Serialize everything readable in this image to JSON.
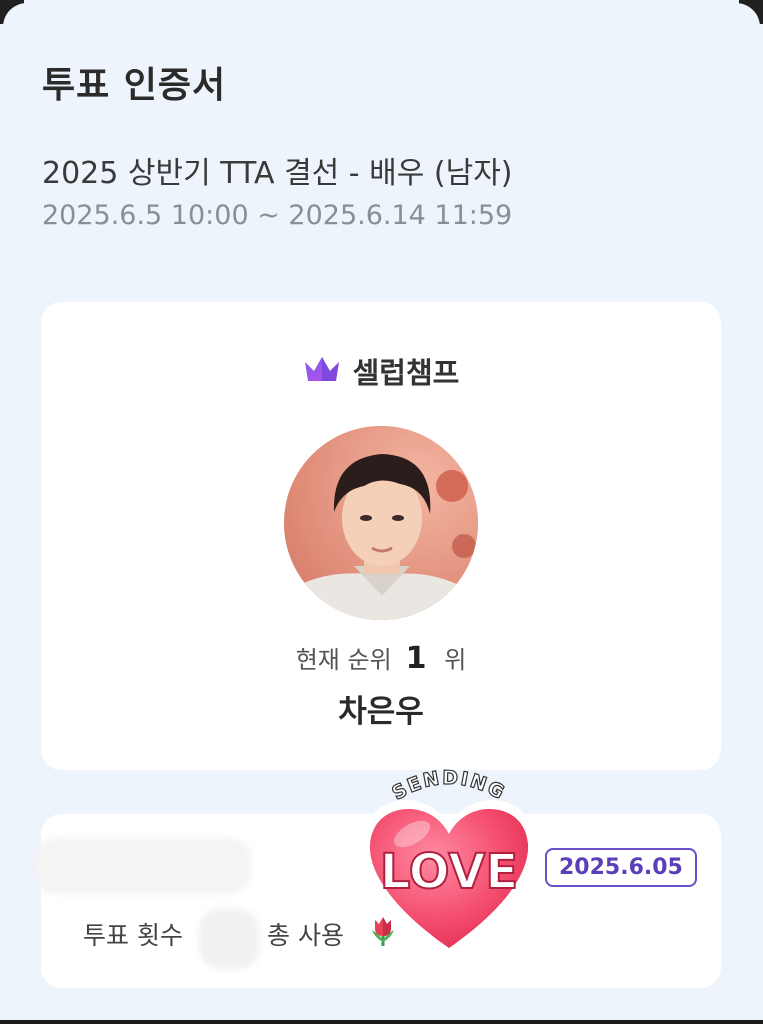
{
  "header": {
    "title": "투표 인증서",
    "event_title": "2025 상반기 TTA 결선 - 배우 (남자)",
    "event_period": "2025.6.5 10:00 ~ 2025.6.14 11:59"
  },
  "brand": {
    "name": "셀럽챔프",
    "icon": "crown-icon",
    "icon_colors": [
      "#7b5cf5",
      "#c14ee0"
    ]
  },
  "candidate": {
    "rank_label": "현재 순위",
    "rank": "1",
    "rank_suffix": "위",
    "name": "차은우"
  },
  "vote_info": {
    "vote_count_label": "투표 횟수",
    "total_use_label": "총 사용",
    "item_icon": "tulip-icon",
    "date_badge": "2025.6.05"
  },
  "sticker": {
    "top_text": "SENDING",
    "main_text": "LOVE"
  },
  "colors": {
    "background": "#eef4fb",
    "card": "#ffffff",
    "accent": "#6a4ec8"
  }
}
